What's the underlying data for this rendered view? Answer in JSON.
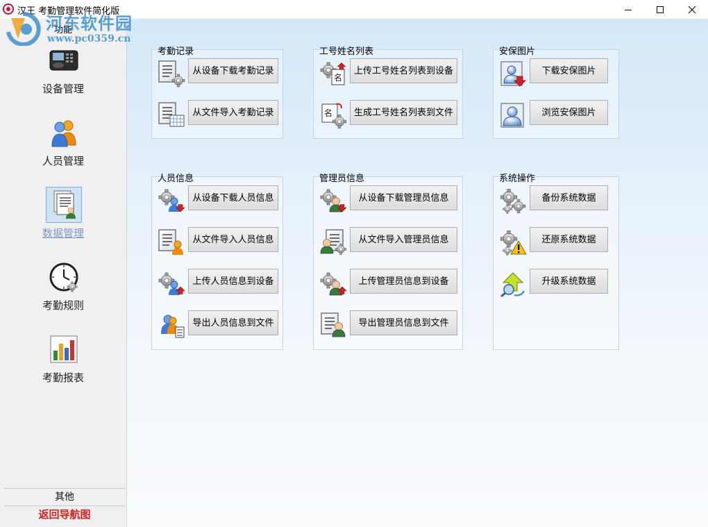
{
  "window": {
    "title": "汉王 考勤管理软件简化版",
    "app_icon": "app-logo-icon",
    "controls": [
      "minimize-icon",
      "maximize-icon",
      "close-icon"
    ]
  },
  "watermark": {
    "site_name": "河东软件园",
    "url": "www.pc0359.cn"
  },
  "sidebar": {
    "title": "功能",
    "items": [
      {
        "label": "设备管理",
        "icon": "device-icon",
        "active": false
      },
      {
        "label": "人员管理",
        "icon": "people-icon",
        "active": false
      },
      {
        "label": "数据管理",
        "icon": "data-document-icon",
        "active": true
      },
      {
        "label": "考勤规则",
        "icon": "clock-icon",
        "active": false
      },
      {
        "label": "考勤报表",
        "icon": "bar-chart-icon",
        "active": false
      }
    ],
    "other_label": "其他",
    "back_label": "返回导航图"
  },
  "groups": {
    "attendance": {
      "title": "考勤记录",
      "buttons": [
        {
          "label": "从设备下载考勤记录",
          "icon": "download-records-icon"
        },
        {
          "label": "从文件导入考勤记录",
          "icon": "import-file-icon"
        }
      ]
    },
    "idname": {
      "title": "工号姓名列表",
      "buttons": [
        {
          "label": "上传工号姓名列表到设备",
          "icon": "upload-list-icon"
        },
        {
          "label": "生成工号姓名列表到文件",
          "icon": "generate-list-icon"
        }
      ]
    },
    "security": {
      "title": "安保图片",
      "buttons": [
        {
          "label": "下载安保图片",
          "icon": "download-photo-icon"
        },
        {
          "label": "浏览安保图片",
          "icon": "browse-photo-icon"
        }
      ]
    },
    "person": {
      "title": "人员信息",
      "buttons": [
        {
          "label": "从设备下载人员信息",
          "icon": "download-person-icon"
        },
        {
          "label": "从文件导入人员信息",
          "icon": "import-person-icon"
        },
        {
          "label": "上传人员信息到设备",
          "icon": "upload-person-icon"
        },
        {
          "label": "导出人员信息到文件",
          "icon": "export-person-icon"
        }
      ]
    },
    "admin": {
      "title": "管理员信息",
      "buttons": [
        {
          "label": "从设备下载管理员信息",
          "icon": "download-admin-icon"
        },
        {
          "label": "从文件导入管理员信息",
          "icon": "import-admin-icon"
        },
        {
          "label": "上传管理员信息到设备",
          "icon": "upload-admin-icon"
        },
        {
          "label": "导出管理员信息到文件",
          "icon": "export-admin-icon"
        }
      ]
    },
    "system": {
      "title": "系统操作",
      "buttons": [
        {
          "label": "备份系统数据",
          "icon": "backup-gears-icon"
        },
        {
          "label": "还原系统数据",
          "icon": "restore-warning-icon"
        },
        {
          "label": "升级系统数据",
          "icon": "upgrade-arrow-icon"
        }
      ]
    }
  }
}
